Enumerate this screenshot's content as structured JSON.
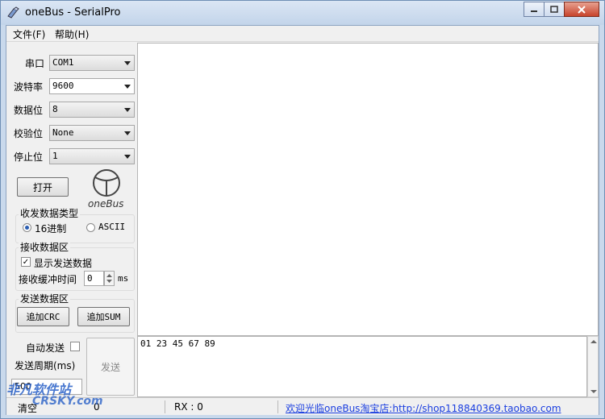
{
  "window": {
    "title": "oneBus - SerialPro"
  },
  "menu": [
    "文件(F)",
    "帮助(H)"
  ],
  "settings": {
    "port": {
      "label": "串口",
      "value": "COM1"
    },
    "baud": {
      "label": "波特率",
      "value": "9600"
    },
    "databits": {
      "label": "数据位",
      "value": "8"
    },
    "parity": {
      "label": "校验位",
      "value": "None"
    },
    "stopbits": {
      "label": "停止位",
      "value": "1"
    }
  },
  "open_button": "打开",
  "logo_text": "oneBus",
  "data_type": {
    "title": "收发数据类型",
    "hex": "16进制",
    "ascii": "ASCII"
  },
  "recv_group": {
    "title": "接收数据区",
    "show_send": "显示发送数据",
    "buffer_label": "接收缓冲时间",
    "buffer_value": "0",
    "unit": "ms"
  },
  "send_group": {
    "title": "发送数据区",
    "add_crc": "追加CRC",
    "add_sum": "追加SUM"
  },
  "send_panel": {
    "auto_send": "自动发送",
    "period_label": "发送周期(ms)",
    "period_value": "500",
    "send_button": "发送",
    "clear_label": "清空"
  },
  "send_text": "01 23 45 67 89",
  "status": {
    "tx": "0",
    "rx": "RX : 0",
    "link": "欢迎光临oneBus淘宝店:http://shop118840369.taobao.com"
  },
  "watermark": {
    "line1": "非凡软件站",
    "line2": "CRSKY.com"
  }
}
